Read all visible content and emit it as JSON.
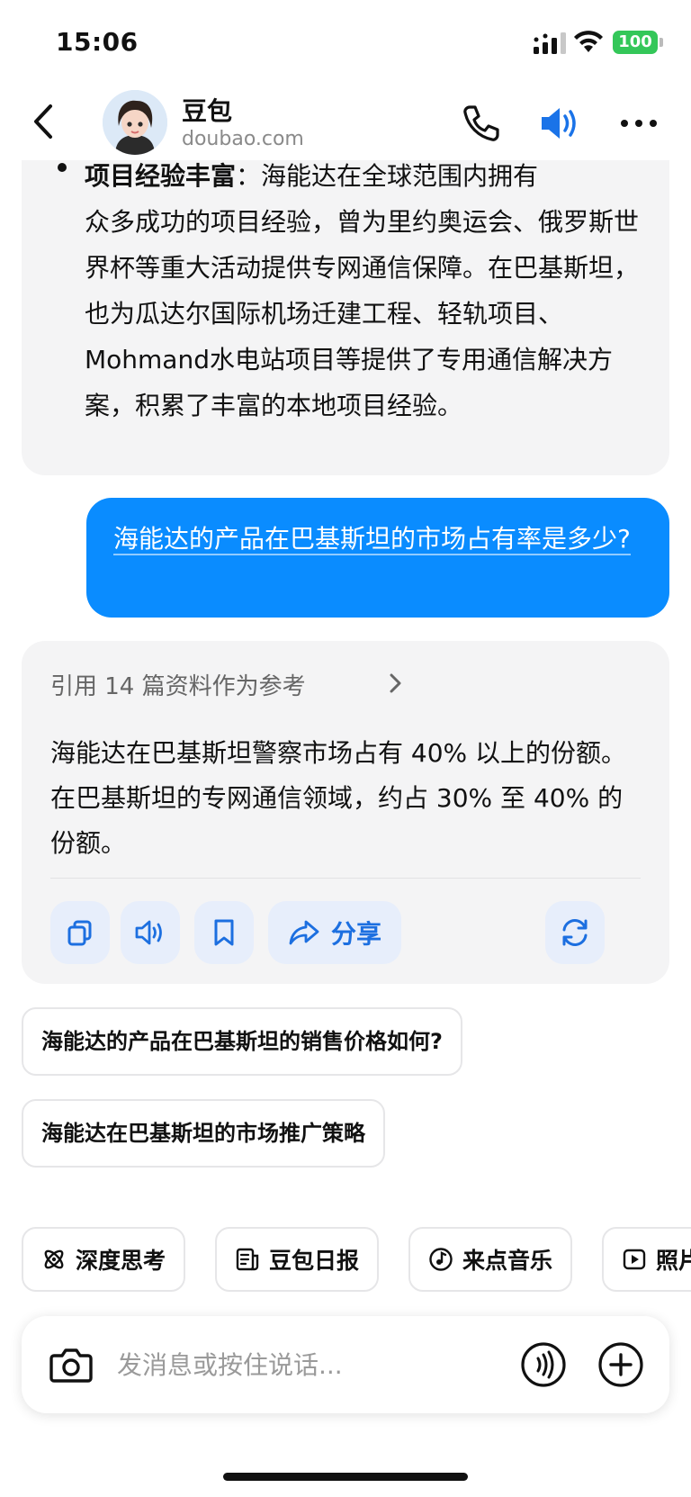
{
  "status_bar": {
    "time": "15:06",
    "battery": "100"
  },
  "header": {
    "back_icon": "chevron-left-icon",
    "bot_name": "豆包",
    "bot_domain": "doubao.com",
    "phone_icon": "phone-icon",
    "speaker_icon": "speaker-icon",
    "more_icon": "more-horizontal-icon",
    "accent_color": "#1a73e8"
  },
  "previous_answer": {
    "bullet_title": "项目经验丰富",
    "bullet_title_suffix": "：海能达在全球范围内拥有",
    "body": "众多成功的项目经验，曾为里约奥运会、俄罗斯世界杯等重大活动提供专网通信保障。在巴基斯坦，也为瓜达尔国际机场迁建工程、轻轨项目、Mohmand水电站项目等提供了专用通信解决方案，积累了丰富的本地项目经验。"
  },
  "user_message": {
    "text": "海能达的产品在巴基斯坦的市场占有率是多少?",
    "bubble_color": "#0a8cff"
  },
  "answer": {
    "references": "引用 14 篇资料作为参考",
    "text": "海能达在巴基斯坦警察市场占有 40% 以上的份额。在巴基斯坦的专网通信领域，约占 30% 至 40% 的份额。",
    "actions": {
      "copy_icon": "copy-icon",
      "read_aloud_icon": "speaker-icon",
      "bookmark_icon": "bookmark-icon",
      "share_icon": "share-icon",
      "share_label": "分享",
      "regenerate_icon": "refresh-icon"
    }
  },
  "suggestions": [
    "海能达的产品在巴基斯坦的销售价格如何?",
    "海能达在巴基斯坦的市场推广策略"
  ],
  "feature_chips": [
    {
      "label": "深度思考",
      "icon": "atom-icon"
    },
    {
      "label": "豆包日报",
      "icon": "newspaper-icon"
    },
    {
      "label": "来点音乐",
      "icon": "music-icon"
    },
    {
      "label": "照片",
      "icon": "play-icon"
    }
  ],
  "input": {
    "placeholder": "发消息或按住说话...",
    "value": "",
    "camera_icon": "camera-icon",
    "voice_icon": "voice-wave-icon",
    "plus_icon": "plus-icon"
  }
}
